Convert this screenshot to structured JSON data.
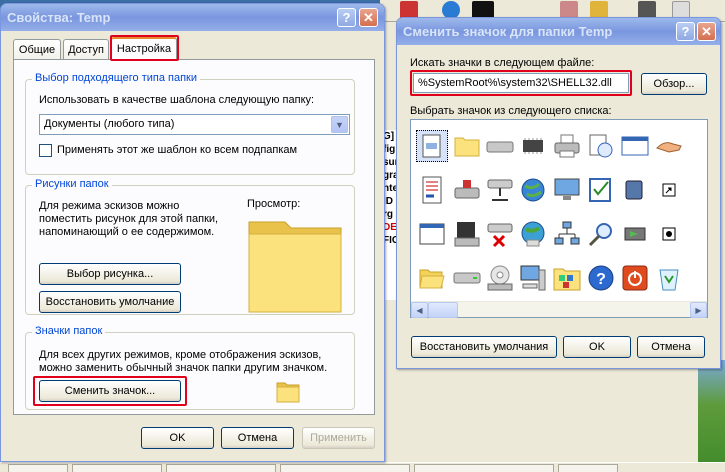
{
  "props_window": {
    "title": "Свойства: Temp",
    "tabs": [
      "Общие",
      "Доступ",
      "Настройка"
    ],
    "group_folder_type": {
      "title": "Выбор подходящего типа папки",
      "label": "Использовать в качестве шаблона следующую папку:",
      "selected": "Документы (любого типа)",
      "checkbox_label": "Применять этот же шаблон ко всем подпапкам"
    },
    "group_pictures": {
      "title": "Рисунки папок",
      "description": "Для режима эскизов можно поместить рисунок для этой папки, напоминающий о ее содержимом.",
      "preview_label": "Просмотр:",
      "choose_button": "Выбор рисунка...",
      "restore_button": "Восстановить умолчание"
    },
    "group_icons": {
      "title": "Значки папок",
      "description": "Для всех других режимов, кроме отображения эскизов, можно заменить обычный значок папки другим значком.",
      "change_button": "Сменить значок..."
    },
    "ok": "OK",
    "cancel": "Отмена",
    "apply": "Применить"
  },
  "icon_window": {
    "title": "Сменить значок для папки Temp",
    "search_label": "Искать значки в следующем файле:",
    "file_path": "%SystemRoot%\\system32\\SHELL32.dll",
    "browse": "Обзор...",
    "list_label": "Выбрать значок из следующего списка:",
    "restore": "Восстановить умолчания",
    "ok": "OK",
    "cancel": "Отмена"
  },
  "background": {
    "list_fragments": [
      "G]",
      "fig",
      "sun",
      "gra",
      "nte",
      "ID",
      "rg",
      "DE",
      "FIC"
    ]
  },
  "colors": {
    "xp_title_active": "#0a58e6",
    "highlight_box": "#e0001c",
    "group_title": "#0046d5"
  }
}
